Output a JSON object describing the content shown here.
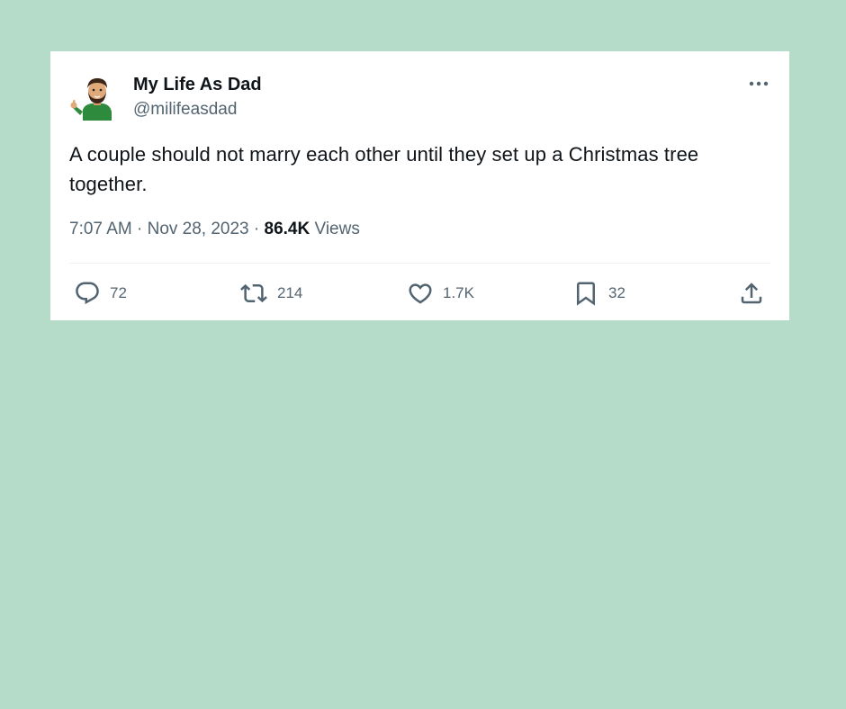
{
  "tweet": {
    "author_name": "My Life As Dad",
    "author_handle": "@milifeasdad",
    "text": "A couple should not marry each other until they set up a Christmas tree together.",
    "timestamp": "7:07 AM · Nov 28, 2023 · ",
    "views_count": "86.4K",
    "views_label": " Views"
  },
  "actions": {
    "replies": "72",
    "reposts": "214",
    "likes": "1.7K",
    "bookmarks": "32"
  },
  "icons": {
    "more": "more-horizontal-icon",
    "reply": "reply-bubble-icon",
    "repost": "repost-icon",
    "like": "heart-icon",
    "bookmark": "bookmark-icon",
    "share": "share-upload-icon"
  },
  "colors": {
    "background": "#b5dcc8",
    "card": "#ffffff",
    "primary_text": "#0f1419",
    "secondary_text": "#536471",
    "divider": "#eff3f4"
  }
}
